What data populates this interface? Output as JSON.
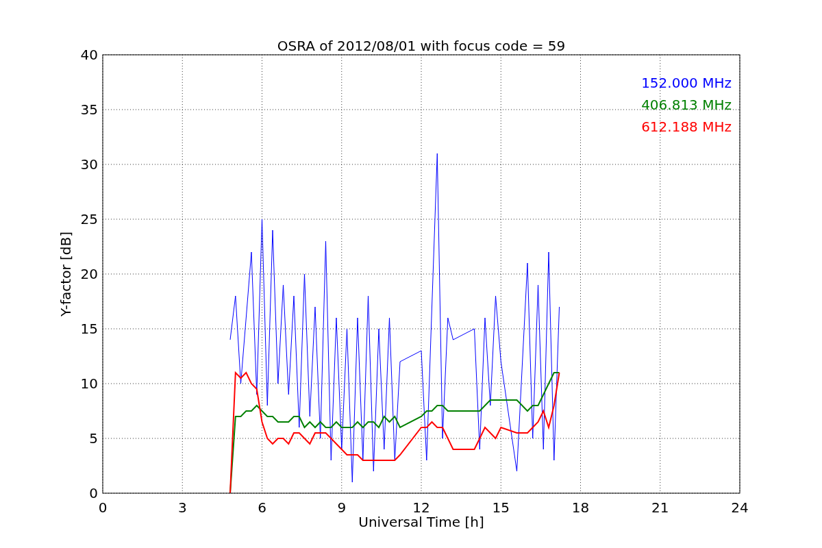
{
  "figure": {
    "chart_data": {
      "type": "line",
      "title": "OSRA of 2012/08/01 with focus code = 59",
      "xlabel": "Universal Time [h]",
      "ylabel": "Y-factor [dB]",
      "x": [
        4.8,
        5.0,
        5.2,
        5.4,
        5.6,
        5.8,
        6.0,
        6.2,
        6.4,
        6.6,
        6.8,
        7.0,
        7.2,
        7.4,
        7.6,
        7.8,
        8.0,
        8.2,
        8.4,
        8.6,
        8.8,
        9.0,
        9.2,
        9.4,
        9.6,
        9.8,
        10.0,
        10.2,
        10.4,
        10.6,
        10.8,
        11.0,
        11.2,
        12.0,
        12.2,
        12.4,
        12.6,
        12.8,
        13.0,
        13.2,
        14.0,
        14.2,
        14.4,
        14.6,
        14.8,
        15.0,
        15.6,
        16.0,
        16.2,
        16.4,
        16.6,
        16.8,
        17.0,
        17.2
      ],
      "series": [
        {
          "name": "152.000 MHz",
          "color": "#0000ff",
          "values": [
            14,
            18,
            10,
            16,
            22,
            9,
            25,
            8,
            24,
            10,
            19,
            9,
            18,
            6,
            20,
            7,
            17,
            5,
            23,
            3,
            16,
            4,
            15,
            1,
            16,
            3,
            18,
            2,
            15,
            4,
            16,
            3,
            12,
            13,
            3,
            17,
            31,
            5,
            16,
            14,
            15,
            4,
            16,
            8,
            18,
            12,
            2,
            21,
            5,
            19,
            4,
            22,
            3,
            17
          ]
        },
        {
          "name": "406.813 MHz",
          "color": "#008000",
          "values": [
            0,
            7,
            7,
            7.5,
            7.5,
            8,
            7.5,
            7,
            7,
            6.5,
            6.5,
            6.5,
            7,
            7,
            6,
            6.5,
            6,
            6.5,
            6,
            6,
            6.5,
            6,
            6,
            6,
            6.5,
            6,
            6.5,
            6.5,
            6,
            7,
            6.5,
            7,
            6,
            7,
            7.5,
            7.5,
            8,
            8,
            7.5,
            7.5,
            7.5,
            7.5,
            8,
            8.5,
            8.5,
            8.5,
            8.5,
            7.5,
            8,
            8,
            9,
            10,
            11,
            11
          ]
        },
        {
          "name": "612.188 MHz",
          "color": "#ff0000",
          "values": [
            0,
            11,
            10.5,
            11,
            10,
            9.5,
            6.5,
            5,
            4.5,
            5,
            5,
            4.5,
            5.5,
            5.5,
            5,
            4.5,
            5.5,
            5.5,
            5.5,
            5,
            4.5,
            4,
            3.5,
            3.5,
            3.5,
            3,
            3,
            3,
            3,
            3,
            3,
            3,
            3.5,
            6,
            6,
            6.5,
            6,
            6,
            5,
            4,
            4,
            5,
            6,
            5.5,
            5,
            6,
            5.5,
            5.5,
            6,
            6.5,
            7.5,
            6,
            8,
            11
          ]
        }
      ],
      "grid": true,
      "xlim": [
        0,
        24
      ],
      "ylim": [
        0,
        40
      ],
      "xticks": [
        0,
        3,
        6,
        9,
        12,
        15,
        18,
        21,
        24
      ],
      "yticks": [
        0,
        5,
        10,
        15,
        20,
        25,
        30,
        35,
        40
      ]
    }
  }
}
